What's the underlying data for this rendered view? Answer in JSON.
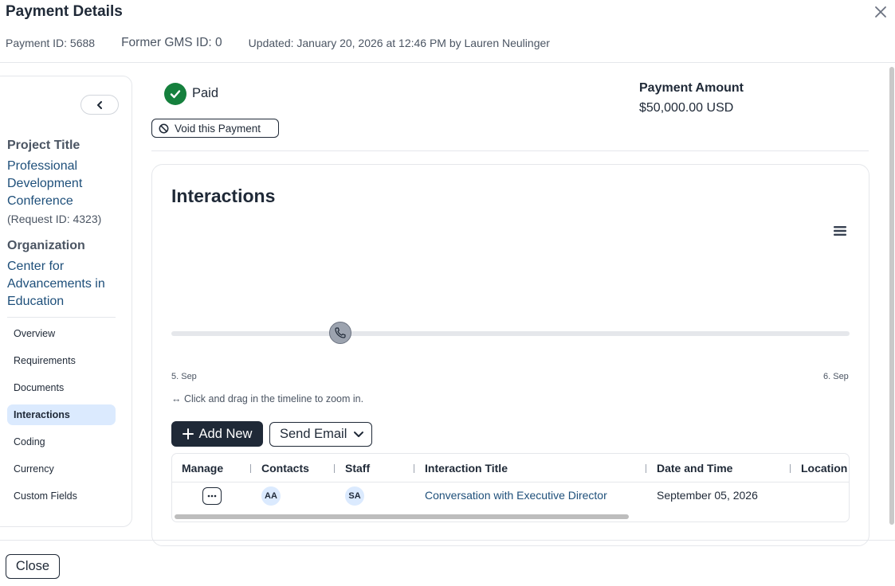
{
  "header": {
    "title": "Payment Details",
    "payment_id": "Payment ID: 5688",
    "former_gms_id": "Former GMS ID: 0",
    "updated": "Updated: January 20, 2026 at 12:46 PM by Lauren Neulinger"
  },
  "sidebar": {
    "project_title_label": "Project Title",
    "project_title": "Professional Development Conference",
    "request_id": "(Request ID: 4323)",
    "organization_label": "Organization",
    "organization": "Center for Advancements in Education",
    "nav": [
      {
        "label": "Overview",
        "active": false
      },
      {
        "label": "Requirements",
        "active": false
      },
      {
        "label": "Documents",
        "active": false
      },
      {
        "label": "Interactions",
        "active": true
      },
      {
        "label": "Coding",
        "active": false
      },
      {
        "label": "Currency",
        "active": false
      },
      {
        "label": "Custom Fields",
        "active": false
      }
    ]
  },
  "status": {
    "label": "Paid",
    "color": "#15803d",
    "void_button": "Void this Payment"
  },
  "amount": {
    "label": "Payment Amount",
    "value": "$50,000.00 USD"
  },
  "interactions": {
    "title": "Interactions",
    "timeline": {
      "start_label": "5. Sep",
      "end_label": "6. Sep",
      "marker_icon": "phone-icon",
      "hint": "↔ Click and drag in the timeline to zoom in."
    },
    "add_new_label": "Add New",
    "send_email_label": "Send Email",
    "table": {
      "columns": [
        "Manage",
        "Contacts",
        "Staff",
        "Interaction Title",
        "Date and Time",
        "Location"
      ],
      "rows": [
        {
          "contacts": "AA",
          "staff": "SA",
          "title": "Conversation with Executive Director",
          "date": "September 05, 2026",
          "location": ""
        }
      ]
    }
  },
  "footer": {
    "close_label": "Close"
  },
  "colors": {
    "accent": "#1e4f7a",
    "dark_button": "#1f2937",
    "active_nav": "#dbeafe"
  }
}
